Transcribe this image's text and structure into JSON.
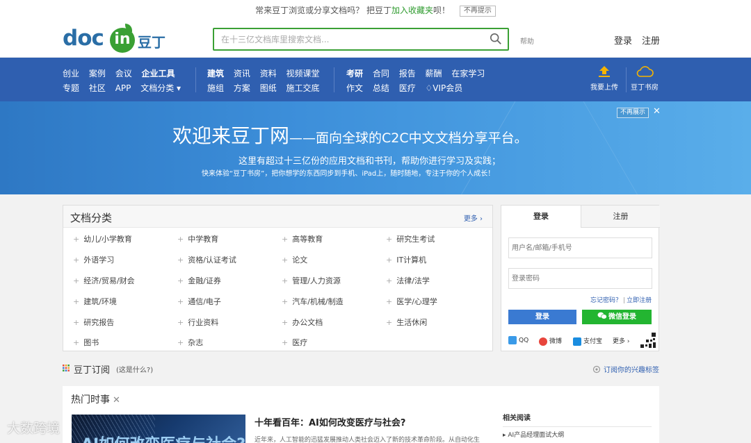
{
  "topbar": {
    "text_pre": "常来豆丁浏览或分享文档吗？ 把豆丁",
    "text_hl": "加入收藏夹",
    "text_post": "呗！",
    "no_more": "不再提示"
  },
  "header": {
    "logo_doc": "doc",
    "logo_in": "in",
    "logo_cn": "豆丁",
    "search_placeholder": "在十三亿文档库里搜索文档...",
    "help": "帮助",
    "login": "登录",
    "register": "注册"
  },
  "nav": {
    "group1_row1": [
      "创业",
      "案例",
      "会议",
      "企业工具"
    ],
    "group1_row2": [
      "专题",
      "社区",
      "APP",
      "文档分类 ▾"
    ],
    "group2_row1": [
      "建筑",
      "资讯",
      "资料",
      "视频课堂"
    ],
    "group2_row2": [
      "施组",
      "方案",
      "图纸",
      "施工交底"
    ],
    "group3_row1": [
      "考研",
      "合同",
      "报告",
      "薪酬",
      "在家学习"
    ],
    "group3_row2": [
      "作文",
      "总结",
      "医疗",
      "♢VIP会员"
    ],
    "upload": "我要上传",
    "bookroom": "豆丁书房"
  },
  "banner": {
    "title_main": "欢迎来豆丁网",
    "title_sub": "——面向全球的C2C中文文档分享平台。",
    "line2": "这里有超过十三亿份的应用文档和书刊，帮助你进行学习及实践；",
    "line3": "快来体验“豆丁书房”，把你想学的东西同步到手机、iPad上，随时随地，专注于你的个人成长！",
    "no_more": "不再展示",
    "close": "✕"
  },
  "categories": {
    "title": "文档分类",
    "more": "更多 ›",
    "items": [
      "幼儿/小学教育",
      "中学教育",
      "高等教育",
      "研究生考试",
      "外语学习",
      "资格/认证考试",
      "论文",
      "IT计算机",
      "经济/贸易/财会",
      "金融/证券",
      "管理/人力资源",
      "法律/法学",
      "建筑/环境",
      "通信/电子",
      "汽车/机械/制造",
      "医学/心理学",
      "研究报告",
      "行业资料",
      "办公文档",
      "生活休闲",
      "图书",
      "杂志",
      "医疗"
    ]
  },
  "login_panel": {
    "tab_login": "登录",
    "tab_register": "注册",
    "user_placeholder": "用户名/邮箱/手机号",
    "pass_placeholder": "登录密码",
    "forgot": "忘记密码？",
    "sep": "|",
    "register_now": "立即注册",
    "login_btn": "登录",
    "wechat_btn": "微信登录",
    "qq": "QQ",
    "weibo": "微博",
    "alipay": "支付宝",
    "more": "更多 ›"
  },
  "subscribe": {
    "title": "豆丁订阅",
    "what": "(这是什么?)",
    "tag_link": "订阅你的兴趣标签"
  },
  "hot": {
    "title": "热门时事",
    "close": "✕",
    "image_text": "AI如何改变医疗与社会?",
    "headline": "十年看百年：AI如何改变医疗与社会?",
    "desc": "近年来，人工智能的迅猛发展推动人类社会迈入了新的技术革命阶段。从自动化生",
    "related_title": "相关阅读",
    "related_item": "AI产品经理面试大纲"
  },
  "watermark": "大数跨境",
  "colors": {
    "brand_blue": "#2f5fb0",
    "brand_green": "#3aa034",
    "wechat_green": "#23b531"
  }
}
